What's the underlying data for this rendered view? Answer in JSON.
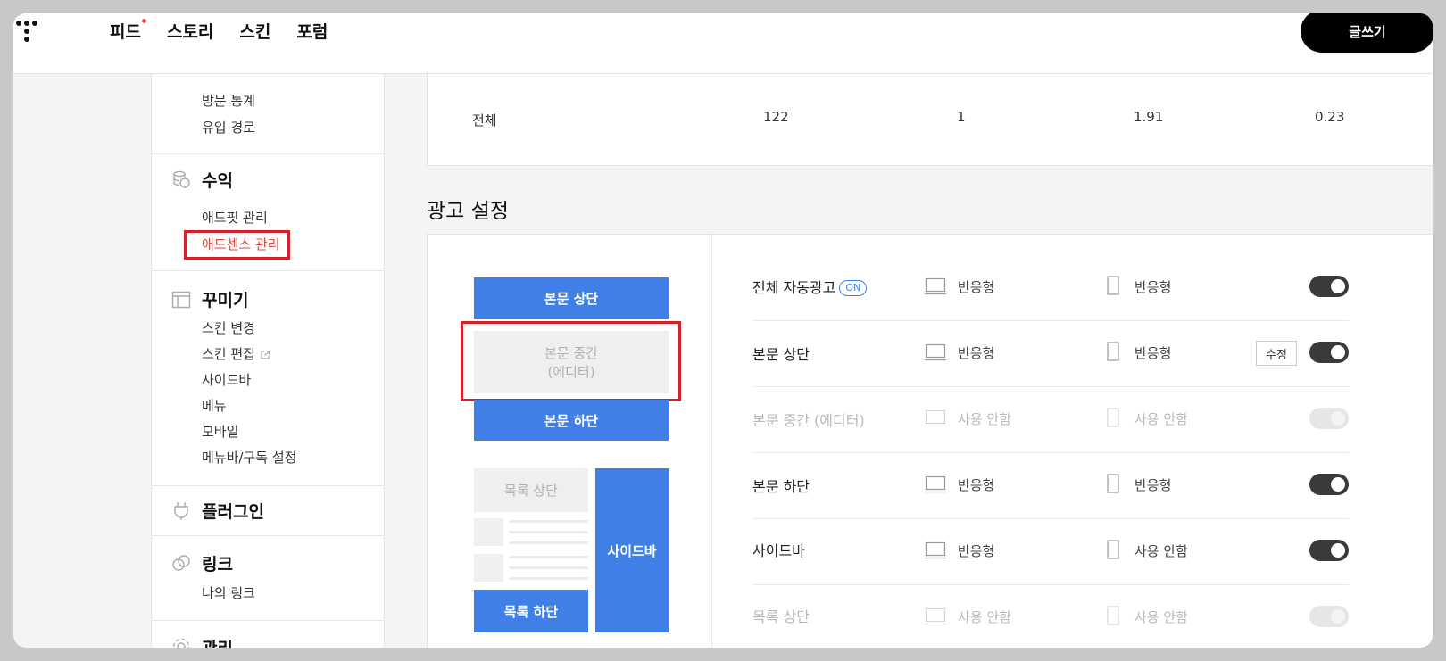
{
  "nav": {
    "items": [
      "피드",
      "스토리",
      "스킨",
      "포럼"
    ],
    "write_label": "글쓰기"
  },
  "sidebar": {
    "stats_links": [
      "방문 통계",
      "유입 경로"
    ],
    "revenue": {
      "title": "수익",
      "links": [
        "애드핏 관리",
        "애드센스 관리"
      ]
    },
    "decorate": {
      "title": "꾸미기",
      "links": [
        "스킨 변경",
        "스킨 편집",
        "사이드바",
        "메뉴",
        "모바일",
        "메뉴바/구독 설정"
      ]
    },
    "plugin": {
      "title": "플러그인"
    },
    "link": {
      "title": "링크",
      "links": [
        "나의 링크"
      ]
    },
    "manage": {
      "title": "관리"
    }
  },
  "stats": {
    "row_label": "전체",
    "values": [
      "122",
      "1",
      "1.91",
      "0.23"
    ]
  },
  "ad_settings": {
    "title": "광고 설정",
    "preview": {
      "body_top": "본문 상단",
      "body_middle_line1": "본문 중간",
      "body_middle_line2": "(에디터)",
      "body_bottom": "본문 하단",
      "list_top": "목록 상단",
      "list_bottom": "목록 하단",
      "sidebar": "사이드바"
    },
    "on_badge": "ON",
    "edit_label": "수정",
    "rows": [
      {
        "name": "전체 자동광고",
        "pc": "반응형",
        "mobile": "반응형"
      },
      {
        "name": "본문 상단",
        "pc": "반응형",
        "mobile": "반응형"
      },
      {
        "name": "본문 중간 (에디터)",
        "pc": "사용 안함",
        "mobile": "사용 안함"
      },
      {
        "name": "본문 하단",
        "pc": "반응형",
        "mobile": "반응형"
      },
      {
        "name": "사이드바",
        "pc": "반응형",
        "mobile": "사용 안함"
      },
      {
        "name": "목록 상단",
        "pc": "사용 안함",
        "mobile": "사용 안함"
      }
    ]
  }
}
